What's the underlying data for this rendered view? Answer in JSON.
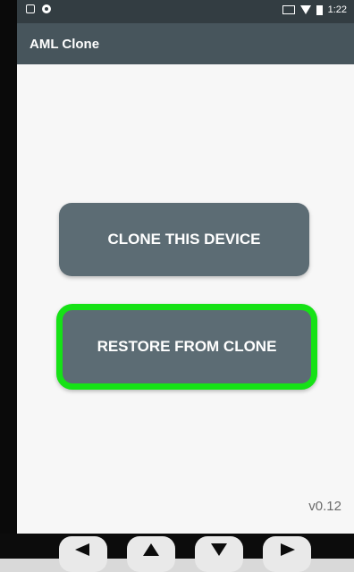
{
  "app": {
    "title": "AML Clone"
  },
  "status_bar": {
    "time": "1:22"
  },
  "buttons": {
    "clone": "CLONE THIS DEVICE",
    "restore": "RESTORE FROM CLONE"
  },
  "version": "v0.12",
  "colors": {
    "toolbar": "#47555c",
    "status_bar": "#333d42",
    "button": "#5c6c74",
    "highlight": "#16e216"
  },
  "nav": {
    "icons": [
      "arrow-left-icon",
      "arrow-up-icon",
      "arrow-down-icon",
      "arrow-right-icon"
    ]
  }
}
